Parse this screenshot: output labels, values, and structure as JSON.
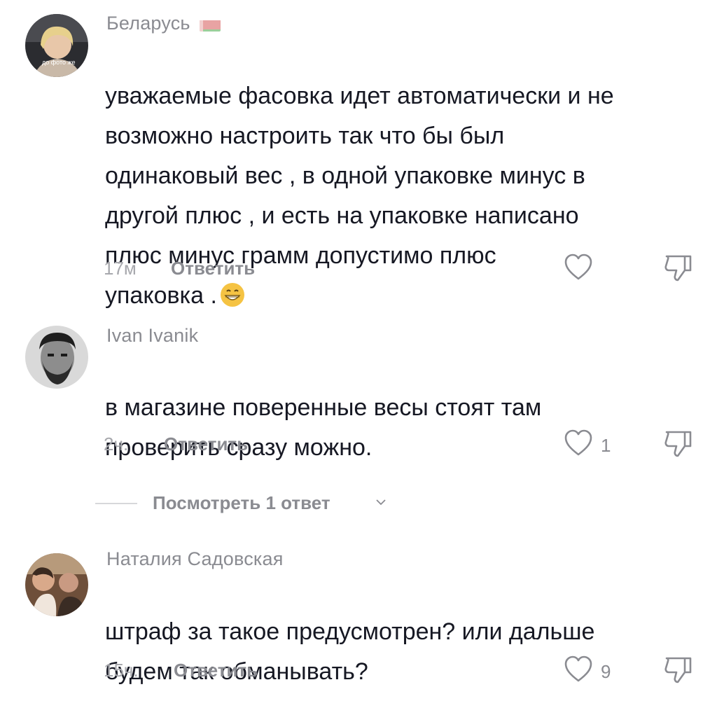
{
  "comments": [
    {
      "author": "Беларусь",
      "text": "уважаемые фасовка идет автоматически и не\nвозможно настроить так что бы был\nодинаковый вес , в одной упаковке минус в\nдругой плюс , и есть на упаковке написано\nплюс минус грамм допустимо плюс\nупаковка .",
      "avatar_text": "до фото же",
      "time": "17м",
      "reply_label": "Ответить",
      "like_count": ""
    },
    {
      "author": "Ivan Ivanik",
      "text": "в магазине поверенные весы стоят там\nпроверить сразу можно.",
      "time": "2ч.",
      "reply_label": "Ответить",
      "like_count": "1"
    },
    {
      "author": "Наталия Садовская",
      "text": "штраф за такое предусмотрен? или дальше\nбудем так обманывать?",
      "time": "15ч.",
      "reply_label": "Ответить",
      "like_count": "9"
    }
  ],
  "view_replies_label": "Посмотреть 1 ответ",
  "icons": {
    "like": "heart-outline-icon",
    "dislike": "thumbs-down-outline-icon",
    "flag": "belarus-flag-icon",
    "emoji": "grinning-face-emoji"
  },
  "colors": {
    "text": "#161823",
    "secondary": "#8a8b91",
    "time": "#a7a8ad",
    "divider": "#d7d8da"
  }
}
